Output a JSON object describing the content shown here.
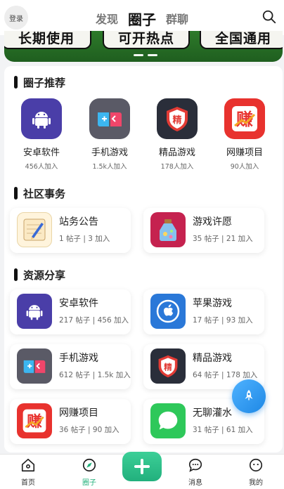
{
  "header": {
    "login_label": "登录",
    "tabs": [
      {
        "label": "发现"
      },
      {
        "label": "圈子"
      },
      {
        "label": "群聊"
      }
    ]
  },
  "banner": {
    "words": [
      "长期使用",
      "可开热点",
      "全国通用"
    ],
    "active_dot": 0
  },
  "sections": {
    "recommend": {
      "title": "圈子推荐",
      "items": [
        {
          "name": "安卓软件",
          "sub": "456人加入",
          "icon": "android-icon"
        },
        {
          "name": "手机游戏",
          "sub": "1.5k人加入",
          "icon": "gamepad-icon"
        },
        {
          "name": "精品游戏",
          "sub": "178人加入",
          "icon": "quality-badge-icon"
        },
        {
          "name": "网赚项目",
          "sub": "90人加入",
          "icon": "money-icon"
        }
      ]
    },
    "community": {
      "title": "社区事务",
      "cards": [
        {
          "title": "站务公告",
          "meta": "1 帖子 | 3 加入",
          "icon": "notepad-icon"
        },
        {
          "title": "游戏许愿",
          "meta": "35 帖子 | 21 加入",
          "icon": "wish-bottle-icon"
        }
      ]
    },
    "resources": {
      "title": "资源分享",
      "cards": [
        {
          "title": "安卓软件",
          "meta": "217 帖子 | 456 加入",
          "icon": "android-icon"
        },
        {
          "title": "苹果游戏",
          "meta": "17 帖子 | 93 加入",
          "icon": "apple-icon"
        },
        {
          "title": "手机游戏",
          "meta": "612 帖子 | 1.5k 加入",
          "icon": "gamepad-icon"
        },
        {
          "title": "精品游戏",
          "meta": "64 帖子 | 178 加入",
          "icon": "quality-badge-icon"
        },
        {
          "title": "网赚项目",
          "meta": "36 帖子 | 90 加入",
          "icon": "money-icon"
        },
        {
          "title": "无聊灌水",
          "meta": "31 帖子 | 61 加入",
          "icon": "chat-bubble-icon"
        }
      ]
    }
  },
  "bottom_nav": [
    {
      "label": "首页",
      "icon": "home-icon"
    },
    {
      "label": "圈子",
      "icon": "compass-icon",
      "active": true
    },
    {
      "label": "",
      "icon": "plus-icon"
    },
    {
      "label": "消息",
      "icon": "message-icon"
    },
    {
      "label": "我的",
      "icon": "profile-icon"
    }
  ],
  "colors": {
    "accent": "#21b07a",
    "banner_green": "#2d7a2a",
    "fab_blue": "#1e88e5"
  }
}
